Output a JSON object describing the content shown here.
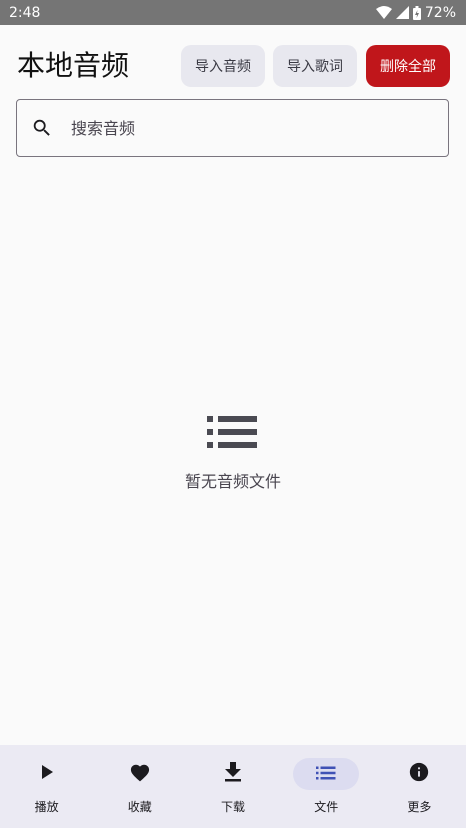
{
  "status_bar": {
    "time": "2:48",
    "battery": "72%",
    "icons": [
      "wifi-icon",
      "signal-icon",
      "battery-charging-icon"
    ]
  },
  "header": {
    "title": "本地音频",
    "import_audio_label": "导入音频",
    "import_lyrics_label": "导入歌词",
    "delete_all_label": "删除全部"
  },
  "search": {
    "icon": "search-icon",
    "placeholder": "搜索音频",
    "value": ""
  },
  "empty_state": {
    "icon": "list-icon",
    "message": "暂无音频文件"
  },
  "bottom_nav": {
    "items": [
      {
        "label": "播放",
        "icon": "play-icon",
        "active": false
      },
      {
        "label": "收藏",
        "icon": "heart-icon",
        "active": false
      },
      {
        "label": "下载",
        "icon": "download-icon",
        "active": false
      },
      {
        "label": "文件",
        "icon": "list-icon",
        "active": true
      },
      {
        "label": "更多",
        "icon": "info-icon",
        "active": false
      }
    ]
  },
  "colors": {
    "status_bar_bg": "#757575",
    "background": "#fafafa",
    "tonal_button_bg": "#e8e8ef",
    "danger_button_bg": "#c0161b",
    "nav_bg": "#ebeaf3",
    "nav_active_pill": "#dcdcf0",
    "active_icon": "#3f51b5"
  }
}
